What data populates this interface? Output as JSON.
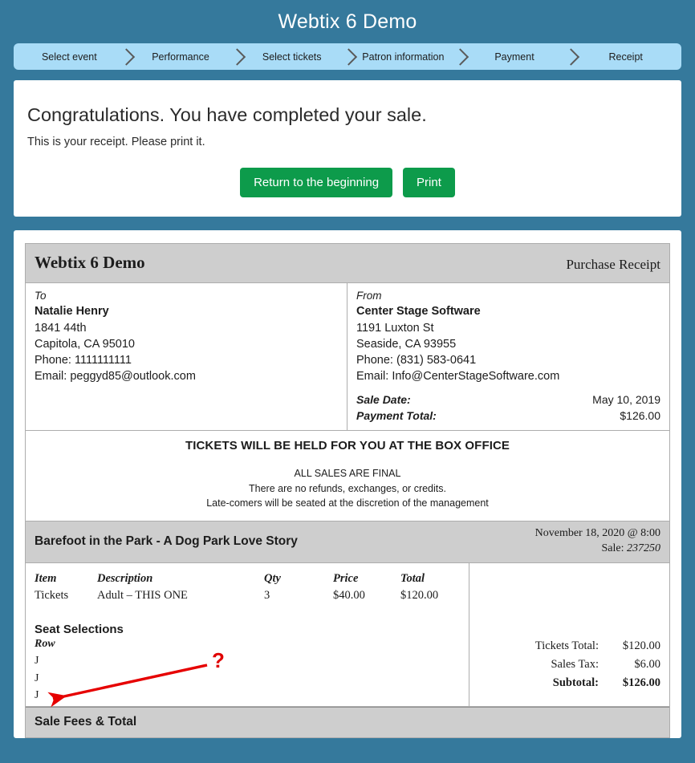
{
  "header": {
    "title": "Webtix 6 Demo",
    "steps": [
      {
        "label": "Select event"
      },
      {
        "label": "Performance"
      },
      {
        "label": "Select tickets"
      },
      {
        "label": "Patron information"
      },
      {
        "label": "Payment"
      },
      {
        "label": "Receipt"
      }
    ]
  },
  "congrats": {
    "title": "Congratulations. You have completed your sale.",
    "subtitle": "This is your receipt. Please print it.",
    "return_button": "Return to the beginning",
    "print_button": "Print"
  },
  "receipt": {
    "header": {
      "title": "Webtix 6 Demo",
      "kind": "Purchase Receipt"
    },
    "to": {
      "label": "To",
      "name": "Natalie Henry",
      "address1": "1841 44th",
      "address2": "Capitola, CA 95010",
      "phone": "Phone: 1111111111",
      "email": "Email: peggyd85@outlook.com"
    },
    "from": {
      "label": "From",
      "name": "Center Stage Software",
      "address1": "1191 Luxton St",
      "address2": "Seaside, CA 93955",
      "phone": "Phone: (831) 583-0641",
      "email": "Email: Info@CenterStageSoftware.com",
      "sale_date_label": "Sale Date:",
      "sale_date_value": "May 10, 2019",
      "payment_total_label": "Payment Total:",
      "payment_total_value": "$126.00"
    },
    "notice": {
      "main": "TICKETS WILL BE HELD FOR YOU AT THE BOX OFFICE",
      "line1": "ALL SALES ARE FINAL",
      "line2": "There are no refunds, exchanges, or credits.",
      "line3": "Late-comers will be seated at the discretion of the management"
    },
    "event": {
      "name": "Barefoot in the Park - A Dog Park Love Story",
      "datetime": "November 18, 2020 @ 8:00",
      "sale_label": "Sale:",
      "sale_number": "237250"
    },
    "items": {
      "columns": [
        "Item",
        "Description",
        "Qty",
        "Price",
        "Total"
      ],
      "rows": [
        {
          "item": "Tickets",
          "description": "Adult – THIS ONE",
          "qty": "3",
          "price": "$40.00",
          "total": "$120.00"
        }
      ]
    },
    "seats": {
      "title": "Seat Selections",
      "column": "Row",
      "rows": [
        "J",
        "J",
        "J"
      ]
    },
    "totals": [
      {
        "label": "Tickets Total:",
        "value": "$120.00",
        "bold": false
      },
      {
        "label": "Sales Tax:",
        "value": "$6.00",
        "bold": false
      },
      {
        "label": "Subtotal:",
        "value": "$126.00",
        "bold": true
      }
    ],
    "fees_title": "Sale Fees & Total"
  },
  "annotation": {
    "question_mark": "?",
    "arrow_color": "#e60000"
  },
  "colors": {
    "page_bg": "#35799c",
    "wizard_bg": "#a9dcf7",
    "button_green": "#0d9b4b",
    "receipt_band": "#cecece"
  }
}
